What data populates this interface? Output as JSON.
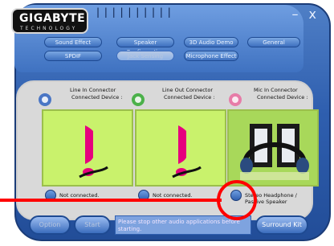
{
  "brand": {
    "name": "GIGABYTE",
    "tagline": "TECHNOLOGY"
  },
  "window_controls": {
    "minimize": "–",
    "close": "x"
  },
  "tabs_row1": [
    {
      "label": "Sound Effect"
    },
    {
      "label": "Speaker Configuration"
    },
    {
      "label": "3D Audio Demo"
    },
    {
      "label": "General"
    }
  ],
  "tabs_row2": [
    {
      "label": "SPDIF"
    },
    {
      "label": "Jack Sensing"
    },
    {
      "label": "Microphone Effect"
    }
  ],
  "connectors": [
    {
      "name": "Line In Connector",
      "device_label": "Connected Device :",
      "ring_color": "blue",
      "status": "Not connected."
    },
    {
      "name": "Line Out Connector",
      "device_label": "Connected Device :",
      "ring_color": "green",
      "status": "Not connected."
    },
    {
      "name": "Mic In Connector",
      "device_label": "Connected Device :",
      "ring_color": "pink",
      "status": "Stereo Headphone / Passive Speaker"
    }
  ],
  "bottom": {
    "left_buttons": [
      "Option",
      "Start"
    ],
    "message": "Please stop other audio applications before starting.",
    "right_button": "Surround Kit"
  },
  "colors": {
    "callout": "#ff0000",
    "card_bg": "#c9f26c"
  },
  "icons": {
    "connector_ring": "ring-icon",
    "warning": "exclamation-icon",
    "headphone": "headphones-icon"
  }
}
